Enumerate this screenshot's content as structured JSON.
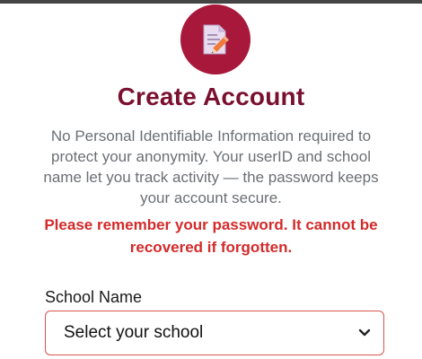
{
  "header": {
    "title": "Create Account",
    "icon": "edit-document-icon"
  },
  "notice": {
    "description": "No Personal Identifiable Information required to protect your anonymity. Your userID and school name let you track activity — the password keeps your account secure.",
    "warning": "Please remember your password. It cannot be recovered if forgotten."
  },
  "form": {
    "school_label": "School Name",
    "school_select_value": "Select your school"
  },
  "colors": {
    "brand": "#a8183a",
    "title": "#7a1030",
    "warning": "#d42a2a",
    "select_border": "#d9534f"
  }
}
